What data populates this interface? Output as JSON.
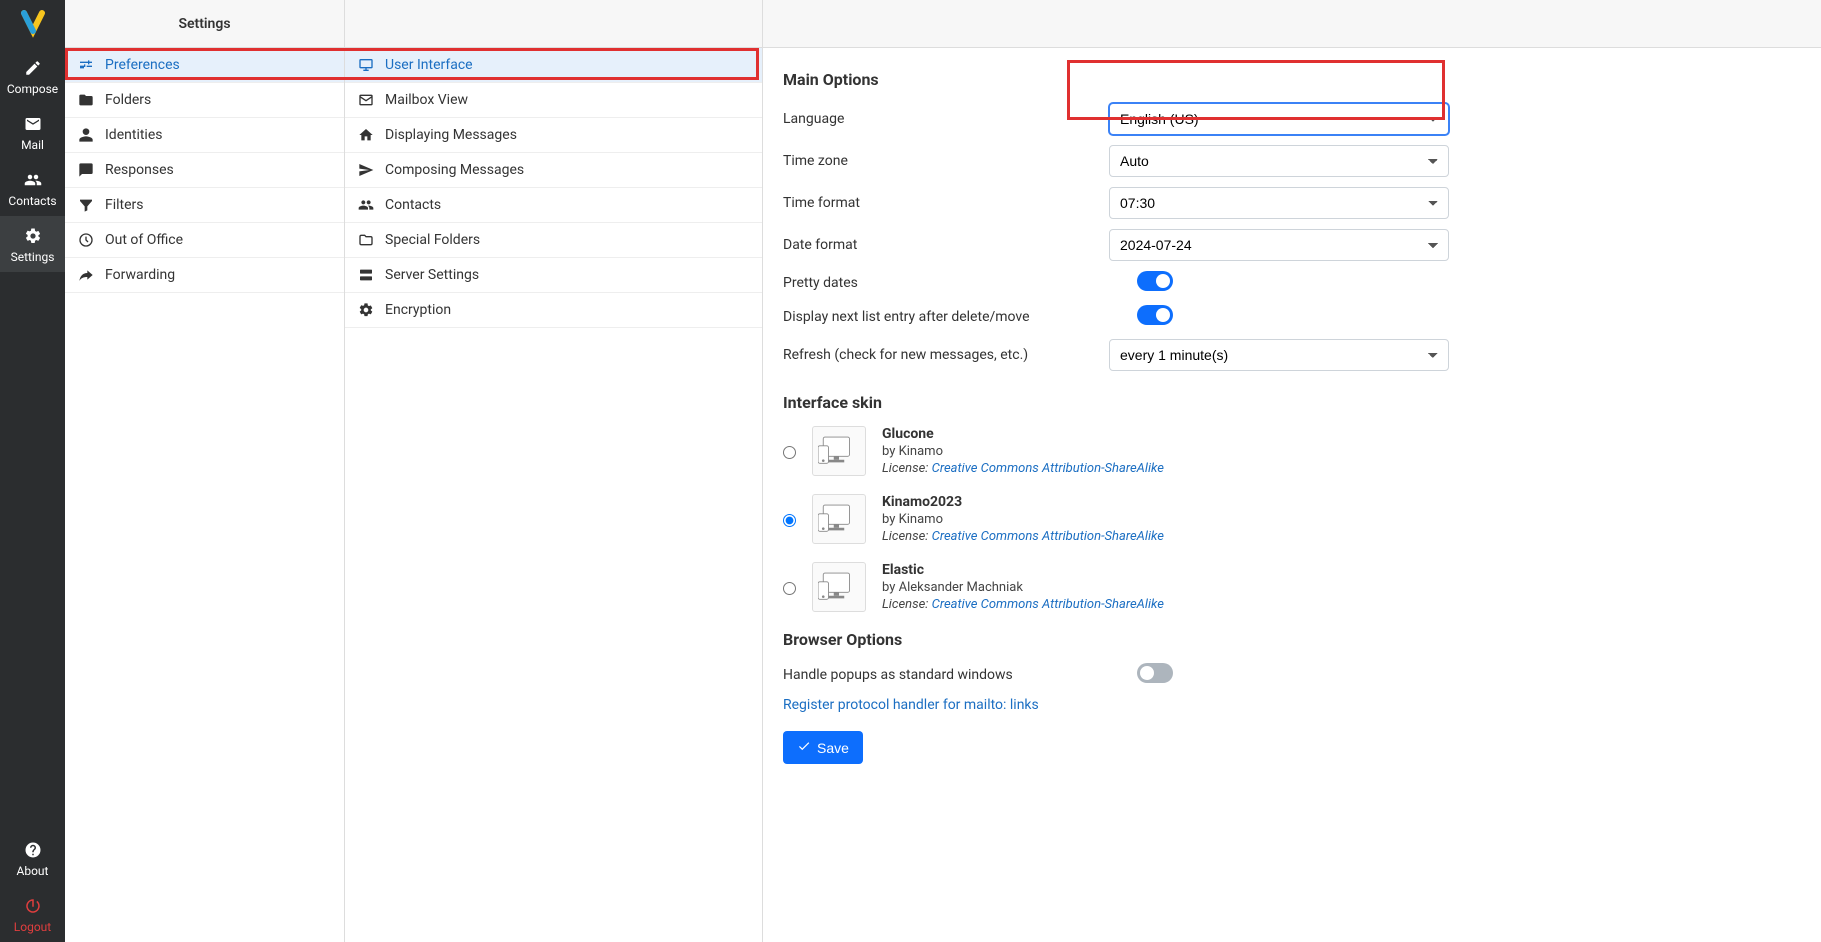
{
  "nav": {
    "compose": "Compose",
    "mail": "Mail",
    "contacts": "Contacts",
    "settings": "Settings",
    "about": "About",
    "logout": "Logout"
  },
  "settings_header": "Settings",
  "settings_list": {
    "preferences": "Preferences",
    "folders": "Folders",
    "identities": "Identities",
    "responses": "Responses",
    "filters": "Filters",
    "ooo": "Out of Office",
    "forwarding": "Forwarding"
  },
  "sections": {
    "ui": "User Interface",
    "mailbox": "Mailbox View",
    "display": "Displaying Messages",
    "compose": "Composing Messages",
    "contacts": "Contacts",
    "special": "Special Folders",
    "server": "Server Settings",
    "encryption": "Encryption"
  },
  "main": {
    "title": "Main Options",
    "language_label": "Language",
    "language_value": "English (US)",
    "timezone_label": "Time zone",
    "timezone_value": "Auto",
    "timeformat_label": "Time format",
    "timeformat_value": "07:30",
    "dateformat_label": "Date format",
    "dateformat_value": "2024-07-24",
    "pretty_label": "Pretty dates",
    "displaynext_label": "Display next list entry after delete/move",
    "refresh_label": "Refresh (check for new messages, etc.)",
    "refresh_value": "every 1 minute(s)"
  },
  "skins": {
    "title": "Interface skin",
    "license_prefix": "License: ",
    "license_link": "Creative Commons Attribution-ShareAlike",
    "items": [
      {
        "name": "Glucone",
        "author": "by Kinamo",
        "selected": false
      },
      {
        "name": "Kinamo2023",
        "author": "by Kinamo",
        "selected": true
      },
      {
        "name": "Elastic",
        "author": "by Aleksander Machniak",
        "selected": false
      }
    ]
  },
  "browser": {
    "title": "Browser Options",
    "popup_label": "Handle popups as standard windows",
    "register_link": "Register protocol handler for mailto: links"
  },
  "save_label": "Save"
}
